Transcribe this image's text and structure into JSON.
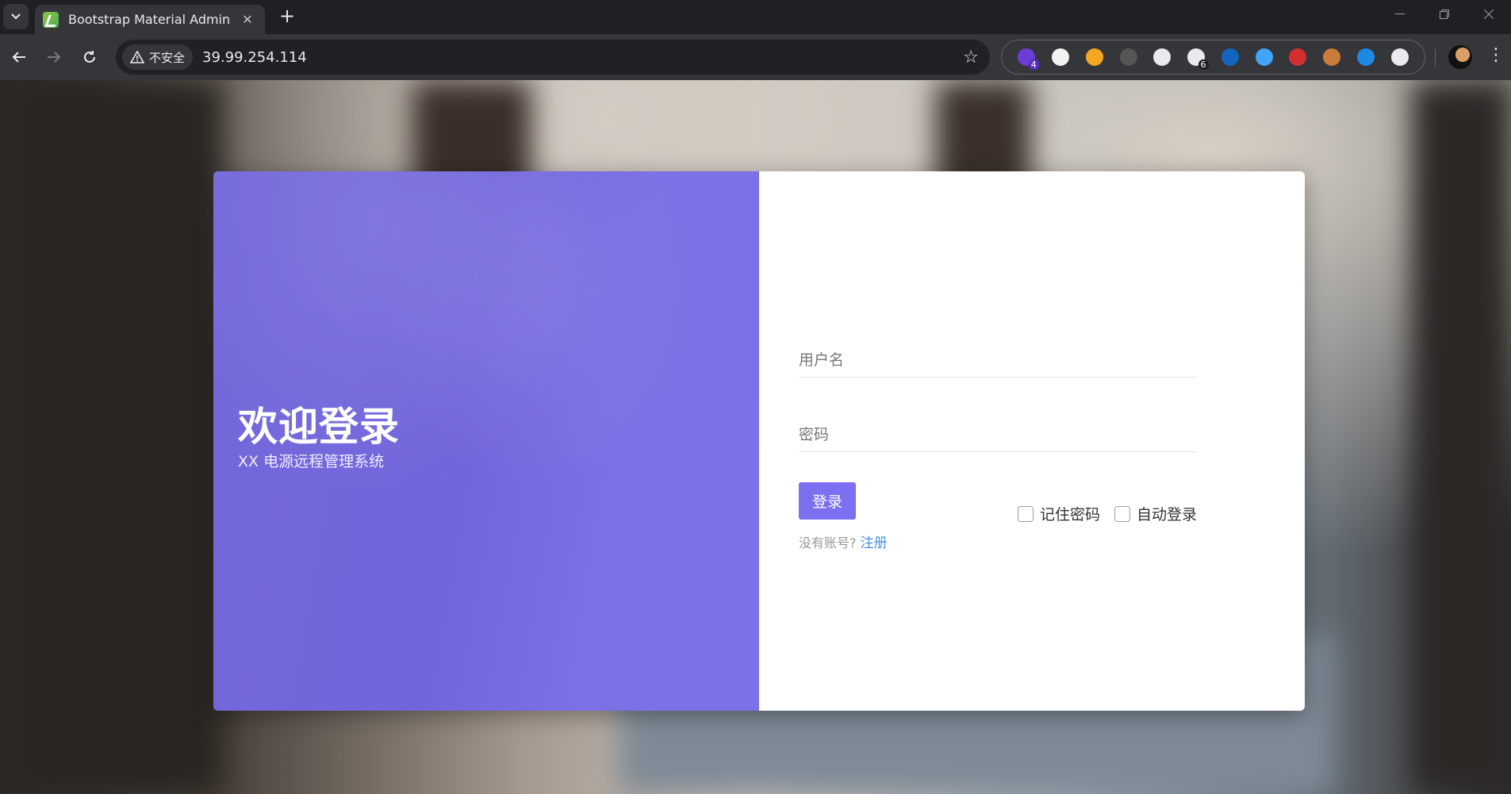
{
  "browser": {
    "tab_title": "Bootstrap Material Admin",
    "tab_close": "✕",
    "new_tab": "+",
    "security_label": "不安全",
    "url": "39.99.254.114",
    "extensions": [
      {
        "name": "ext-purple-icon",
        "color": "#6c3cd6",
        "badge": "4"
      },
      {
        "name": "ext-circle-icon",
        "color": "#f2f2f2"
      },
      {
        "name": "ext-arrow-icon",
        "color": "#f5a623"
      },
      {
        "name": "ext-hat-icon",
        "color": "#555555"
      },
      {
        "name": "ext-face-icon",
        "color": "#e8eaed"
      },
      {
        "name": "ext-qr-icon",
        "color": "#e8eaed",
        "badge": "6"
      },
      {
        "name": "ext-hourglass-icon",
        "color": "#1565c0"
      },
      {
        "name": "ext-glasses-icon",
        "color": "#42a5f5"
      },
      {
        "name": "ext-record-icon",
        "color": "#d32f2f"
      },
      {
        "name": "ext-cookie-icon",
        "color": "#c97b3a"
      },
      {
        "name": "ext-bolt-icon",
        "color": "#1e88e5"
      },
      {
        "name": "ext-puzzle-icon",
        "color": "#e8eaed"
      }
    ]
  },
  "login": {
    "title": "欢迎登录",
    "subtitle": "XX 电源远程管理系统",
    "username_placeholder": "用户名",
    "password_placeholder": "密码",
    "submit_label": "登录",
    "remember_label": "记住密码",
    "auto_login_label": "自动登录",
    "no_account_text": "没有账号?",
    "register_link": "注册"
  },
  "colors": {
    "accent": "#7c6ff0",
    "left_panel": "#7469da",
    "link": "#4d90e2"
  }
}
